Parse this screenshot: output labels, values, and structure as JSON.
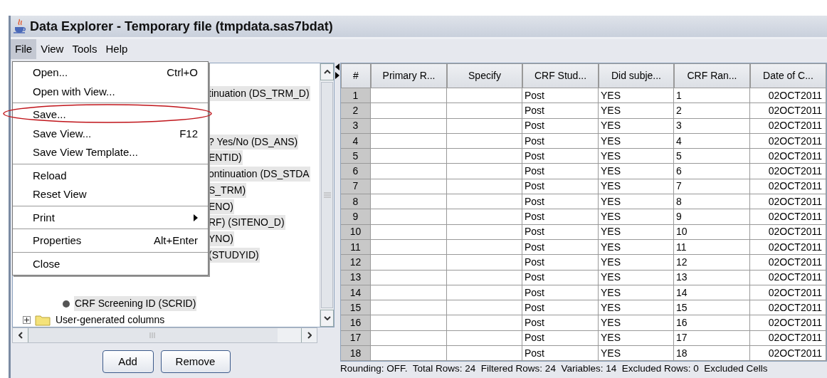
{
  "window": {
    "title": "Data Explorer - Temporary file (tmpdata.sas7bdat)"
  },
  "menu_bar": [
    {
      "label": "File",
      "selected": true
    },
    {
      "label": "View",
      "selected": false
    },
    {
      "label": "Tools",
      "selected": false
    },
    {
      "label": "Help",
      "selected": false
    }
  ],
  "file_menu": [
    {
      "kind": "item",
      "label": "Open...",
      "shortcut": "Ctrl+O"
    },
    {
      "kind": "item",
      "label": "Open with View..."
    },
    {
      "kind": "separator"
    },
    {
      "kind": "item",
      "label": "Save..."
    },
    {
      "kind": "item",
      "label": "Save View...",
      "shortcut": "F12"
    },
    {
      "kind": "item",
      "label": "Save View Template..."
    },
    {
      "kind": "separator"
    },
    {
      "kind": "item",
      "label": "Reload"
    },
    {
      "kind": "item",
      "label": "Reset View"
    },
    {
      "kind": "separator"
    },
    {
      "kind": "submenu",
      "label": "Print"
    },
    {
      "kind": "separator"
    },
    {
      "kind": "item",
      "label": "Properties",
      "shortcut": "Alt+Enter"
    },
    {
      "kind": "separator"
    },
    {
      "kind": "item",
      "label": "Close"
    }
  ],
  "tree": [
    {
      "kind": "hidden"
    },
    {
      "kind": "clipped",
      "label": "tinuation (DS_TRM_D)",
      "selected": true
    },
    {
      "kind": "hidden"
    },
    {
      "kind": "hidden"
    },
    {
      "kind": "clipped",
      "label": "? Yes/No (DS_ANS)",
      "selected": true
    },
    {
      "kind": "clipped",
      "label": "ENTID)",
      "selected": true
    },
    {
      "kind": "clipped",
      "label": "ontinuation (DS_STDA",
      "selected": true
    },
    {
      "kind": "clipped",
      "label": "S_TRM)",
      "selected": true
    },
    {
      "kind": "clipped",
      "label": "ENO)",
      "selected": true
    },
    {
      "kind": "clipped",
      "label": "RF) (SITENO_D)",
      "selected": true
    },
    {
      "kind": "clipped",
      "label": "YNO)",
      "selected": true
    },
    {
      "kind": "clipped",
      "label": "(STUDYID)",
      "selected": true
    },
    {
      "kind": "hidden"
    },
    {
      "kind": "hidden"
    },
    {
      "kind": "leaf",
      "label": "CRF Screening ID (SCRID)",
      "selected": true
    },
    {
      "kind": "folder",
      "label": "User-generated columns",
      "expanded": false,
      "selected": false
    }
  ],
  "buttons": [
    "Add",
    "Remove"
  ],
  "table": {
    "columns": [
      "#",
      "Primary R...",
      "Specify",
      "CRF Stud...",
      "Did subje...",
      "CRF Ran...",
      "Date of C..."
    ],
    "rows": [
      [
        "1",
        "",
        "",
        "Post",
        "YES",
        "1",
        "02OCT2011"
      ],
      [
        "2",
        "",
        "",
        "Post",
        "YES",
        "2",
        "02OCT2011"
      ],
      [
        "3",
        "",
        "",
        "Post",
        "YES",
        "3",
        "02OCT2011"
      ],
      [
        "4",
        "",
        "",
        "Post",
        "YES",
        "4",
        "02OCT2011"
      ],
      [
        "5",
        "",
        "",
        "Post",
        "YES",
        "5",
        "02OCT2011"
      ],
      [
        "6",
        "",
        "",
        "Post",
        "YES",
        "6",
        "02OCT2011"
      ],
      [
        "7",
        "",
        "",
        "Post",
        "YES",
        "7",
        "02OCT2011"
      ],
      [
        "8",
        "",
        "",
        "Post",
        "YES",
        "8",
        "02OCT2011"
      ],
      [
        "9",
        "",
        "",
        "Post",
        "YES",
        "9",
        "02OCT2011"
      ],
      [
        "10",
        "",
        "",
        "Post",
        "YES",
        "10",
        "02OCT2011"
      ],
      [
        "11",
        "",
        "",
        "Post",
        "YES",
        "11",
        "02OCT2011"
      ],
      [
        "12",
        "",
        "",
        "Post",
        "YES",
        "12",
        "02OCT2011"
      ],
      [
        "13",
        "",
        "",
        "Post",
        "YES",
        "13",
        "02OCT2011"
      ],
      [
        "14",
        "",
        "",
        "Post",
        "YES",
        "14",
        "02OCT2011"
      ],
      [
        "15",
        "",
        "",
        "Post",
        "YES",
        "15",
        "02OCT2011"
      ],
      [
        "16",
        "",
        "",
        "Post",
        "YES",
        "16",
        "02OCT2011"
      ],
      [
        "17",
        "",
        "",
        "Post",
        "YES",
        "17",
        "02OCT2011"
      ],
      [
        "18",
        "",
        "",
        "Post",
        "YES",
        "18",
        "02OCT2011"
      ]
    ]
  },
  "status_bar": "Rounding: OFF.  Total Rows: 24  Filtered Rows: 24  Variables: 14  Excluded Rows: 0  Excluded Cells"
}
